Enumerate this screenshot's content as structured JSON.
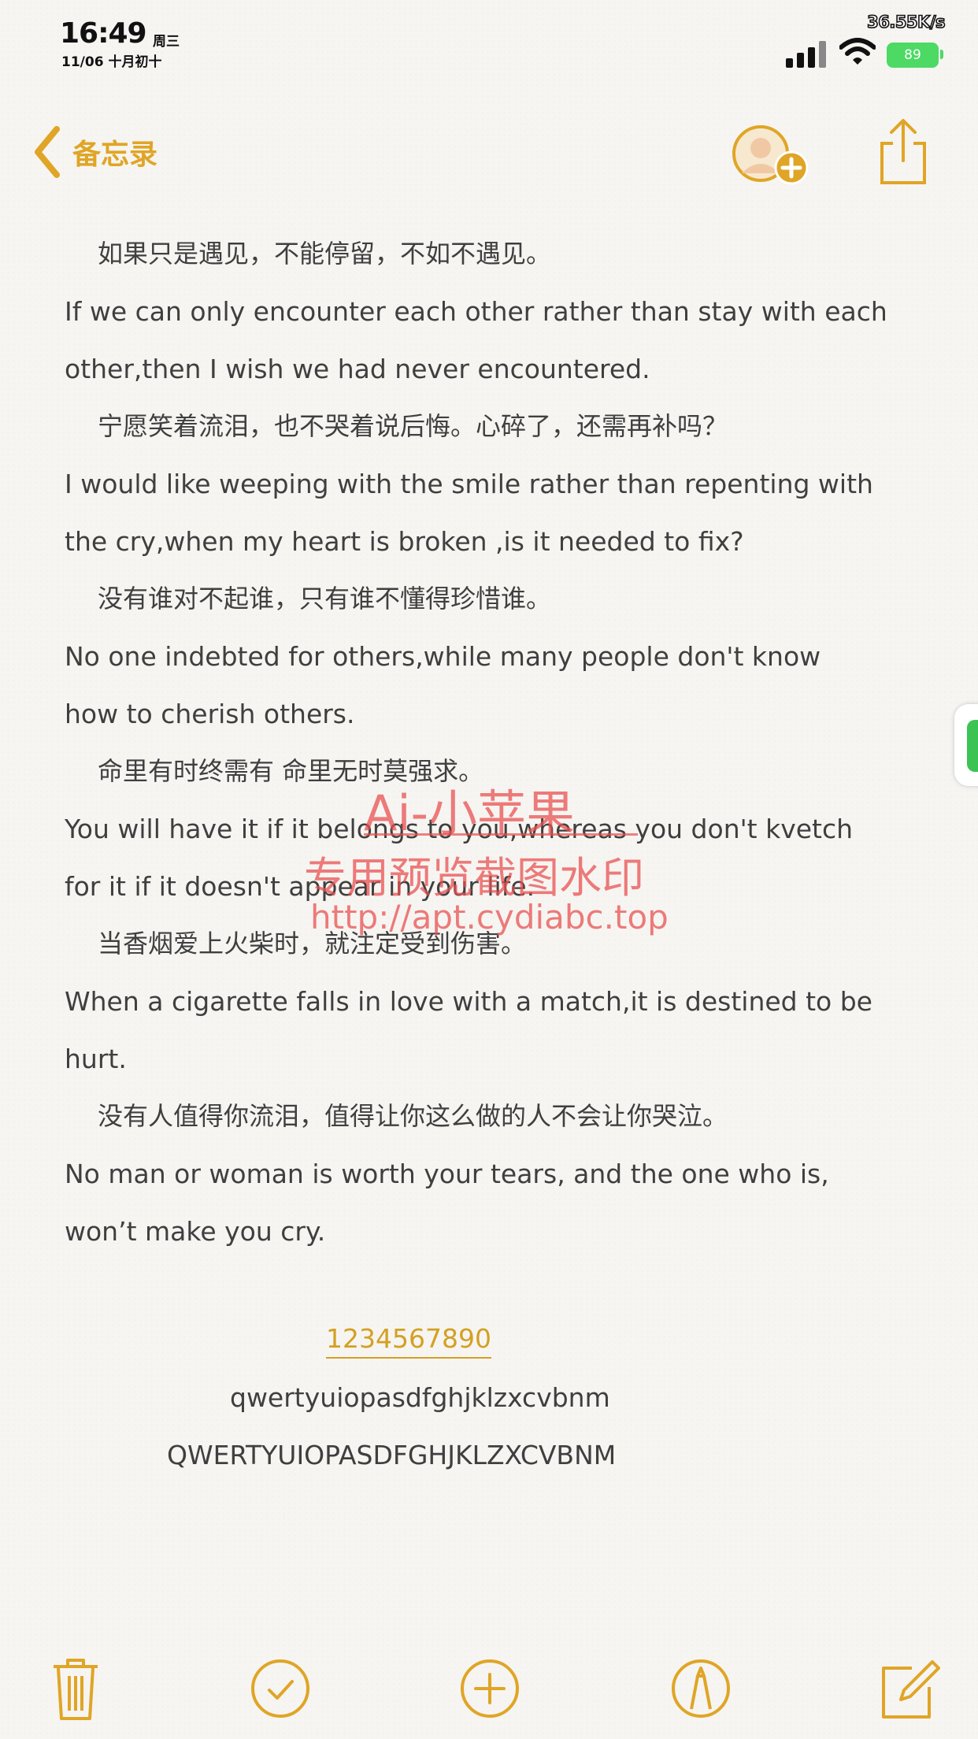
{
  "status_bar": {
    "time": "16:49",
    "weekday": "周三",
    "date": "11/06 十月初十",
    "net_speed": "36.55K/s",
    "battery": "89",
    "signal_icon": "signal-bars-icon",
    "wifi_icon": "wifi-icon"
  },
  "nav": {
    "back_label": "备忘录",
    "back_icon": "chevron-left-icon",
    "add_person_icon": "add-person-icon",
    "share_icon": "share-icon",
    "accent": "#e0a526"
  },
  "note": {
    "lines": [
      {
        "text": "如果只是遇见，不能停留，不如不遇见。",
        "zh": true
      },
      {
        "text": "If we can only encounter each other rather than stay with each",
        "zh": false
      },
      {
        "text": "other,then I wish we had never encountered.",
        "zh": false
      },
      {
        "text": "宁愿笑着流泪，也不哭着说后悔。心碎了，还需再补吗？",
        "zh": true
      },
      {
        "text": "I would like weeping with the smile rather than repenting with",
        "zh": false
      },
      {
        "text": "the cry,when my heart is broken ,is it needed to fix?",
        "zh": false
      },
      {
        "text": "没有谁对不起谁，只有谁不懂得珍惜谁。",
        "zh": true
      },
      {
        "text": "No one indebted for others,while many people don't know",
        "zh": false
      },
      {
        "text": "how to cherish others.",
        "zh": false
      },
      {
        "text": "命里有时终需有 命里无时莫强求。",
        "zh": true
      },
      {
        "text": "You will have it if it belongs to you,whereas you don't kvetch",
        "zh": false
      },
      {
        "text": "for it if it doesn't appear in your life.",
        "zh": false
      },
      {
        "text": "当香烟爱上火柴时，就注定受到伤害。",
        "zh": true
      },
      {
        "text": "When a cigarette falls in love with a match,it is destined to be",
        "zh": false
      },
      {
        "text": "hurt.",
        "zh": false
      },
      {
        "text": "没有人值得你流泪，值得让你这么做的人不会让你哭泣。",
        "zh": true
      },
      {
        "text": "No man or woman is worth your tears, and the one who is,",
        "zh": false
      },
      {
        "text": "won’t make you cry.",
        "zh": false
      }
    ],
    "digits": "1234567890",
    "lowercase": "qwertyuiopasdfghjklzxcvbnm",
    "uppercase": "QWERTYUIOPASDFGHJKLZXCVBNM"
  },
  "watermark": {
    "line1": "Ai-小苹果",
    "line2": "专用预览截图水印",
    "line3": "http://apt.cydiabc.top"
  },
  "toolbar": {
    "items": [
      "trash-icon",
      "checklist-icon",
      "add-icon",
      "markup-icon",
      "compose-icon"
    ]
  }
}
